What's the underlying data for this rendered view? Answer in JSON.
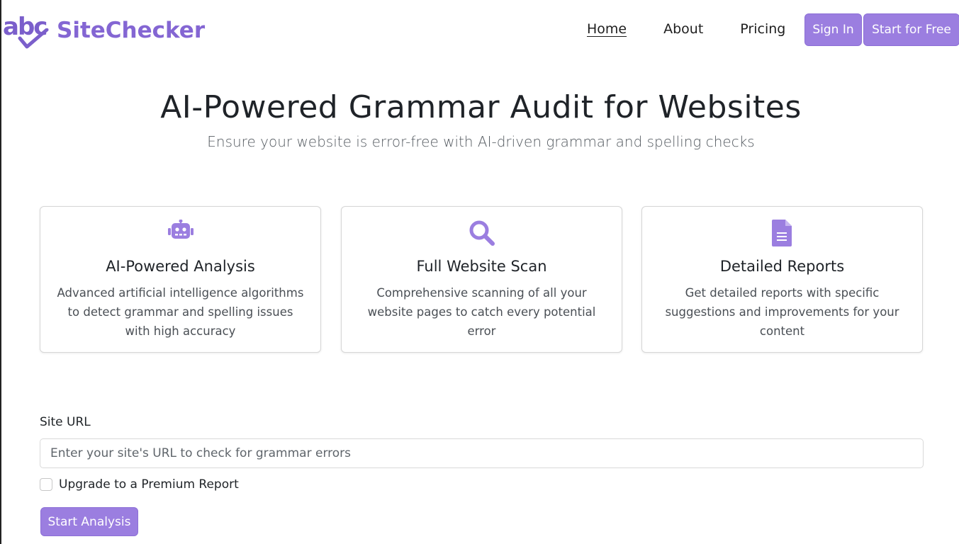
{
  "brand": {
    "logo_text": "abc",
    "name": "SiteChecker",
    "color": "#8466d3"
  },
  "nav": {
    "links": [
      "Home",
      "About",
      "Pricing"
    ],
    "active": "Home",
    "sign_in": "Sign In",
    "start_free": "Start for Free"
  },
  "hero": {
    "title": "AI-Powered Grammar Audit for Websites",
    "subtitle": "Ensure your website is error-free with AI-driven grammar and spelling checks"
  },
  "features": [
    {
      "icon": "robot-icon",
      "title": "AI-Powered Analysis",
      "text": "Advanced artificial intelligence algorithms to detect grammar and spelling issues with high accuracy"
    },
    {
      "icon": "search-icon",
      "title": "Full Website Scan",
      "text": "Comprehensive scanning of all your website pages to catch every potential error"
    },
    {
      "icon": "document-icon",
      "title": "Detailed Reports",
      "text": "Get detailed reports with specific suggestions and improvements for your content"
    }
  ],
  "form": {
    "url_label": "Site URL",
    "url_value": "",
    "url_placeholder": "Enter your site's URL to check for grammar errors",
    "premium_label": "Upgrade to a Premium Report",
    "premium_checked": false,
    "submit_label": "Start Analysis"
  },
  "colors": {
    "accent": "#9b7ee0",
    "icon": "#9b7ee0"
  }
}
